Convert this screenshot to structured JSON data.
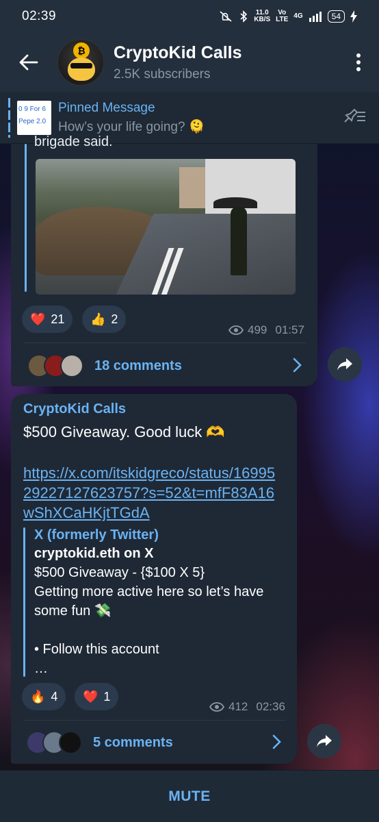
{
  "status_bar": {
    "time": "02:39",
    "speed_value": "11.0",
    "speed_unit": "KB/S",
    "volte_top": "Vo",
    "volte_bottom": "LTE",
    "network": "4G",
    "battery": "54"
  },
  "header": {
    "title": "CryptoKid Calls",
    "subscribers": "2.5K subscribers"
  },
  "pinned": {
    "thumb_line1": "0 9 For 6",
    "thumb_line2": "Pepe 2.0",
    "title": "Pinned Message",
    "message": "How’s your life going? 🫠"
  },
  "post1": {
    "partial_text": "brigade said.",
    "reactions": [
      {
        "emoji": "❤️",
        "count": "21"
      },
      {
        "emoji": "👍",
        "count": "2"
      }
    ],
    "views": "499",
    "time": "01:57",
    "comments": "18 comments"
  },
  "post2": {
    "sender": "CryptoKid Calls",
    "text": "$500 Giveaway. Good luck 🫶",
    "link": "https://x.com/itskidgreco/status/1699529227127623757?s=52&t=mfF83A16wShXCaHKjtTGdA",
    "preview": {
      "site": "X (formerly Twitter)",
      "title": "cryptokid.eth on X",
      "description": "$500 Giveaway - {$100 X 5}\nGetting more active here so let’s have some fun 💸\n\n• Follow this account\n…"
    },
    "reactions": [
      {
        "emoji": "🔥",
        "count": "4"
      },
      {
        "emoji": "❤️",
        "count": "1"
      }
    ],
    "views": "412",
    "time": "02:36",
    "comments": "5 comments"
  },
  "footer": {
    "mute_label": "MUTE"
  },
  "colors": {
    "accent": "#6ab3f3",
    "bubble": "#1f2936",
    "header": "#242f3d"
  }
}
